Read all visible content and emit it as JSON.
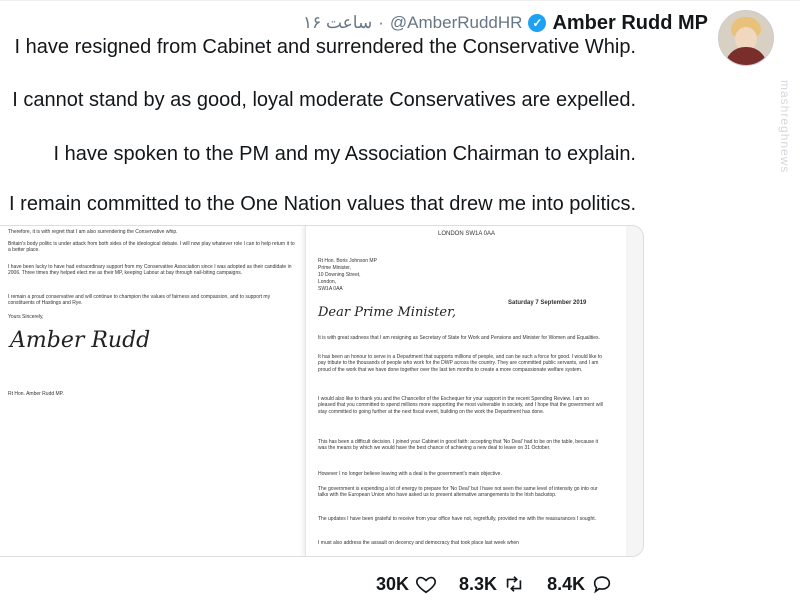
{
  "tweet": {
    "author_name": "Amber Rudd MP",
    "handle": "@AmberRuddHR",
    "separator": "·",
    "time": "۱۶ ساعت",
    "lines": [
      "I have resigned from Cabinet and surrendered the Conservative Whip.",
      "I cannot stand by as good, loyal moderate Conservatives are expelled.",
      "I have spoken to the PM and my Association Chairman to explain.",
      "I remain committed to the One Nation values that drew me into politics."
    ]
  },
  "watermark": "mashreghnews",
  "letter_left": {
    "p1": "Therefore, it is with regret that I am also surrendering the Conservative whip.",
    "p2": "Britain's body politic is under attack from both sides of the ideological debate. I will now play whatever role I can to help return it to a better place.",
    "p3": "I have been lucky to have had extraordinary support from my Conservative Association since I was adopted as their candidate in 2006. Three times they helped elect me as their MP, keeping Labour at bay through nail-biting campaigns.",
    "p4": "I remain a proud conservative and will continue to champion the values of fairness and compassion, and to support my constituents of Hastings and Rye.",
    "closing": "Yours Sincerely,",
    "signature": "Amber Rudd",
    "signatory": "Rt Hon. Amber Rudd MP."
  },
  "letter_right": {
    "header": "LONDON SW1A 0AA",
    "address": [
      "Rt Hon. Boris Johnson MP",
      "Prime Minister,",
      "10 Downing Street,",
      "London,",
      "SW1A 0AA"
    ],
    "date": "Saturday 7 September 2019",
    "salutation": "Dear Prime Minister,",
    "p1": "It is with great sadness that I am resigning as Secretary of State for Work and Pensions and Minister for Women and Equalities.",
    "p2": "It has been an honour to serve in a Department that supports millions of people, and can be such a force for good. I would like to pay tribute to the thousands of people who work for the DWP across the country. They are committed public servants, and I am proud of the work that we have done together over the last ten months to create a more compassionate welfare system.",
    "p3": "I would also like to thank you and the Chancellor of the Exchequer for your support in the recent Spending Review. I am so pleased that you committed to spend millions more supporting the most vulnerable in society, and I hope that the government will stay committed to going further at the next fiscal event, building on the work the Department has done.",
    "p4": "This has been a difficult decision. I joined your Cabinet in good faith: accepting that 'No Deal' had to be on the table, because it was the means by which we would have the best chance of achieving a new deal to leave on 31 October.",
    "p5": "However I no longer believe leaving with a deal is the government's main objective.",
    "p6": "The government is expending a lot of energy to prepare for 'No Deal' but I have not seen the same level of intensity go into our talks with the European Union who have asked us to present alternative arrangements to the Irish backstop.",
    "p7": "The updates I have been grateful to receive from your office have not, regretfully, provided me with the reassurances I sought.",
    "p8": "I must also address the assault on decency and democracy that took place last week when"
  },
  "actions": {
    "likes": "30K",
    "retweets": "8.3K",
    "replies": "8.4K"
  },
  "colors": {
    "verified": "#1da1f2",
    "secondary_text": "#657786",
    "primary_text": "#14171a"
  }
}
